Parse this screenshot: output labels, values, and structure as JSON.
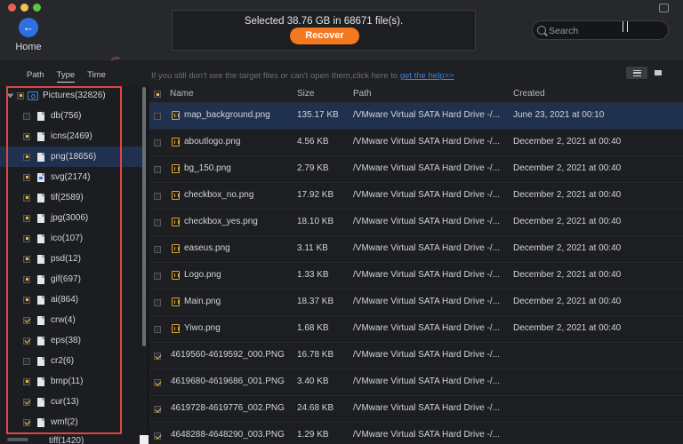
{
  "window": {
    "home_label": "Home",
    "watermark": "SoftwarePC"
  },
  "status": {
    "text": "Selected 38.76 GB in 68671 file(s).",
    "recover_label": "Recover"
  },
  "search": {
    "placeholder": "Search"
  },
  "tabs": [
    {
      "label": "Path"
    },
    {
      "label": "Type"
    },
    {
      "label": "Time"
    }
  ],
  "hint": {
    "text": "If you still don't see the target files or can't open them,click here to ",
    "link": "get the help>>"
  },
  "sidebar": {
    "root": {
      "label": "Pictures(32826)",
      "state": "partial"
    },
    "items": [
      {
        "label": "db(756)",
        "state": "none"
      },
      {
        "label": "icns(2469)",
        "state": "partial"
      },
      {
        "label": "png(18656)",
        "state": "partial"
      },
      {
        "label": "svg(2174)",
        "state": "partial"
      },
      {
        "label": "tif(2589)",
        "state": "partial"
      },
      {
        "label": "jpg(3006)",
        "state": "partial"
      },
      {
        "label": "ico(107)",
        "state": "partial"
      },
      {
        "label": "psd(12)",
        "state": "partial"
      },
      {
        "label": "gif(697)",
        "state": "partial"
      },
      {
        "label": "ai(864)",
        "state": "partial"
      },
      {
        "label": "crw(4)",
        "state": "checked"
      },
      {
        "label": "eps(38)",
        "state": "checked"
      },
      {
        "label": "cr2(6)",
        "state": "none"
      },
      {
        "label": "bmp(11)",
        "state": "partial"
      },
      {
        "label": "cur(13)",
        "state": "checked"
      },
      {
        "label": "wmf(2)",
        "state": "checked"
      }
    ],
    "cut_item": "tiff(1420)"
  },
  "table": {
    "columns": {
      "name": "Name",
      "size": "Size",
      "path": "Path",
      "created": "Created"
    },
    "rows": [
      {
        "name": "map_background.png",
        "size": "135.17 KB",
        "path": "/VMware Virtual SATA Hard Drive -/...",
        "created": "June 23, 2021 at 00:10",
        "state": "none",
        "icon": true
      },
      {
        "name": "aboutlogo.png",
        "size": "4.56 KB",
        "path": "/VMware Virtual SATA Hard Drive -/...",
        "created": "December 2, 2021 at 00:40",
        "state": "none",
        "icon": true
      },
      {
        "name": "bg_150.png",
        "size": "2.79 KB",
        "path": "/VMware Virtual SATA Hard Drive -/...",
        "created": "December 2, 2021 at 00:40",
        "state": "none",
        "icon": true
      },
      {
        "name": "checkbox_no.png",
        "size": "17.92 KB",
        "path": "/VMware Virtual SATA Hard Drive -/...",
        "created": "December 2, 2021 at 00:40",
        "state": "none",
        "icon": true
      },
      {
        "name": "checkbox_yes.png",
        "size": "18.10 KB",
        "path": "/VMware Virtual SATA Hard Drive -/...",
        "created": "December 2, 2021 at 00:40",
        "state": "none",
        "icon": true
      },
      {
        "name": "easeus.png",
        "size": "3.11 KB",
        "path": "/VMware Virtual SATA Hard Drive -/...",
        "created": "December 2, 2021 at 00:40",
        "state": "none",
        "icon": true
      },
      {
        "name": "Logo.png",
        "size": "1.33 KB",
        "path": "/VMware Virtual SATA Hard Drive -/...",
        "created": "December 2, 2021 at 00:40",
        "state": "none",
        "icon": true
      },
      {
        "name": "Main.png",
        "size": "18.37 KB",
        "path": "/VMware Virtual SATA Hard Drive -/...",
        "created": "December 2, 2021 at 00:40",
        "state": "none",
        "icon": true
      },
      {
        "name": "Yiwo.png",
        "size": "1.68 KB",
        "path": "/VMware Virtual SATA Hard Drive -/...",
        "created": "December 2, 2021 at 00:40",
        "state": "none",
        "icon": true
      },
      {
        "name": "4619560-4619592_000.PNG",
        "size": "16.78 KB",
        "path": "/VMware Virtual SATA Hard Drive -/...",
        "created": "",
        "state": "checked",
        "icon": false
      },
      {
        "name": "4619680-4619686_001.PNG",
        "size": "3.40 KB",
        "path": "/VMware Virtual SATA Hard Drive -/...",
        "created": "",
        "state": "checked",
        "icon": false
      },
      {
        "name": "4619728-4619776_002.PNG",
        "size": "24.68 KB",
        "path": "/VMware Virtual SATA Hard Drive -/...",
        "created": "",
        "state": "checked",
        "icon": false
      },
      {
        "name": "4648288-4648290_003.PNG",
        "size": "1.29 KB",
        "path": "/VMware Virtual SATA Hard Drive -/...",
        "created": "",
        "state": "checked",
        "icon": false
      }
    ]
  }
}
